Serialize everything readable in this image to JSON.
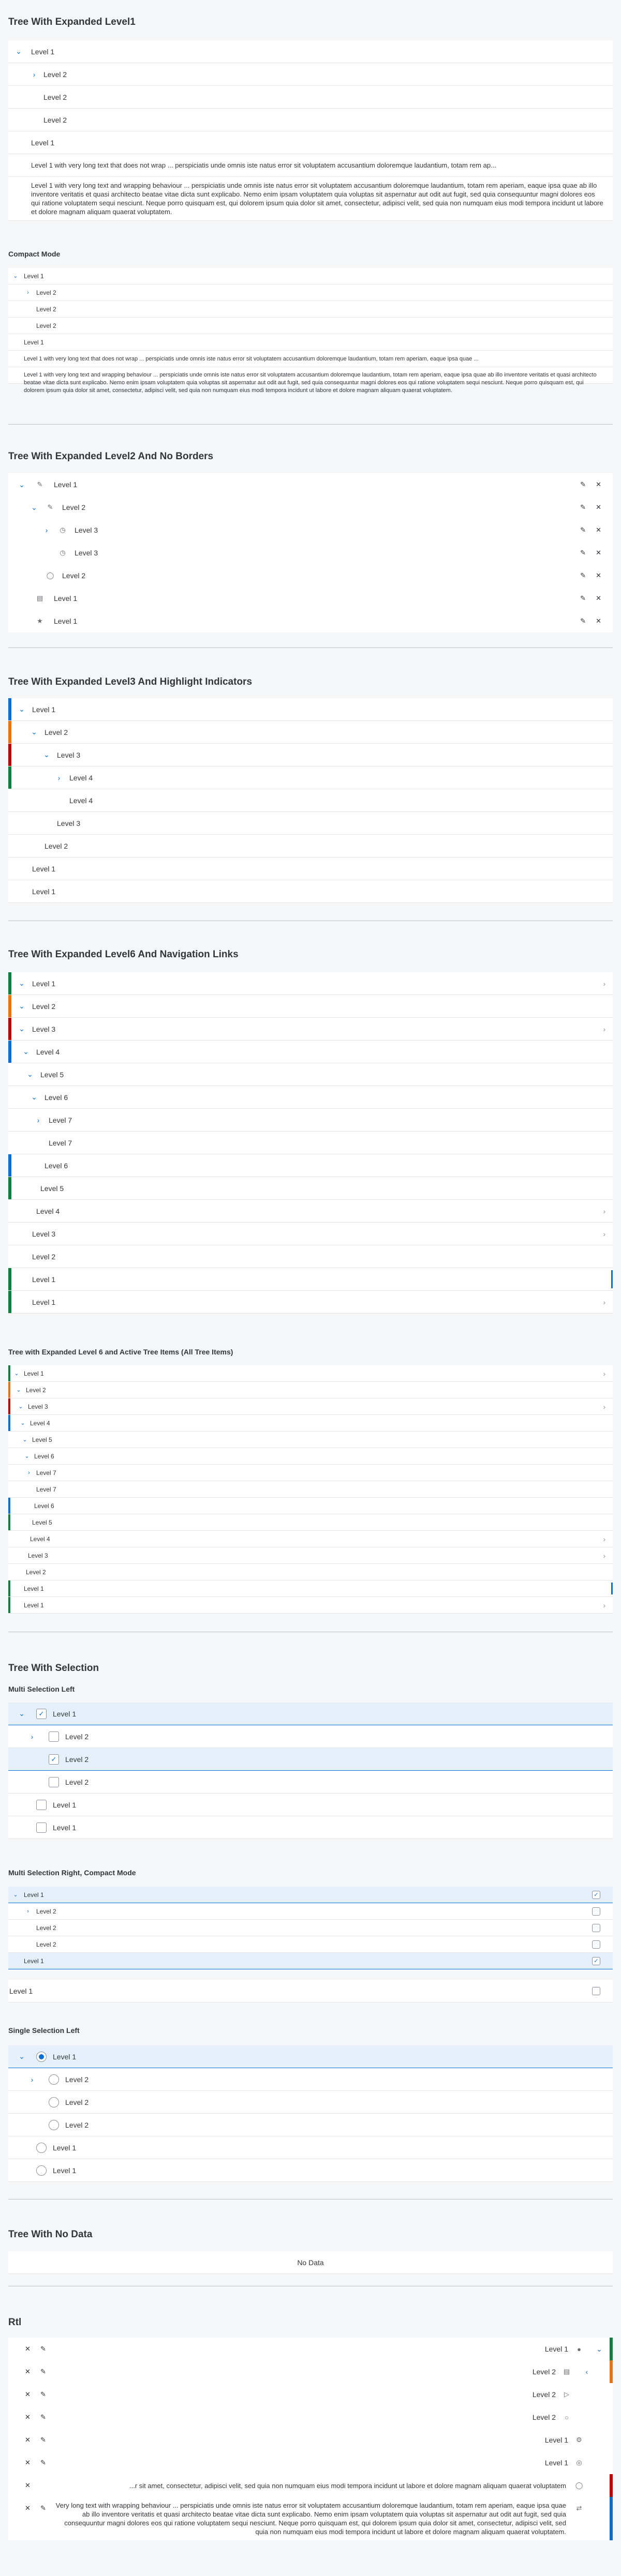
{
  "colors": {
    "accent": "#0a6ed1",
    "negative": "#bb0000",
    "critical": "#e9730c",
    "positive": "#107e3e",
    "info": "#0a6ed1"
  },
  "sections": {
    "s1": "Tree With Expanded Level1",
    "s1c": "Compact Mode",
    "s2": "Tree With Expanded Level2 And No Borders",
    "s3": "Tree With Expanded Level3 And Highlight Indicators",
    "s4": "Tree With Expanded Level6 And Navigation Links",
    "s4c": "Tree with Expanded Level 6 and Active Tree Items (All Tree Items)",
    "s5": "Tree With Selection",
    "s5a": "Multi Selection Left",
    "s5b": "Multi Selection Right, Compact Mode",
    "s5c": "Single Selection Left",
    "s6": "Tree With No Data",
    "s7": "Rtl"
  },
  "labels": {
    "l1": "Level 1",
    "l2": "Level 2",
    "l3": "Level 3",
    "l4": "Level 4",
    "l5": "Level 5",
    "l6": "Level 6",
    "l7": "Level 7",
    "nodata": "No Data"
  },
  "texts": {
    "trunc": "Level 1 with very long text that does not wrap ... perspiciatis unde omnis iste natus error sit voluptatem accusantium doloremque laudantium, totam rem ap...",
    "trunc_c": "Level 1 with very long text that does not wrap ... perspiciatis unde omnis iste natus error sit voluptatem accusantium doloremque laudantium, totam rem aperiam, eaque ipsa quae ...",
    "wrap": "Level 1 with very long text and wrapping behaviour ... perspiciatis unde omnis iste natus error sit voluptatem accusantium doloremque laudantium, totam rem aperiam, eaque ipsa quae ab illo inventore veritatis et quasi architecto beatae vitae dicta sunt explicabo. Nemo enim ipsam voluptatem quia voluptas sit aspernatur aut odit aut fugit, sed quia consequuntur magni dolores eos qui ratione voluptatem sequi nesciunt. Neque porro quisquam est, qui dolorem ipsum quia dolor sit amet, consectetur, adipisci velit, sed quia non numquam eius modi tempora incidunt ut labore et dolore magnam aliquam quaerat voluptatem.",
    "wrap_c": "Level 1 with very long text and wrapping behaviour ... perspiciatis unde omnis iste natus error sit voluptatem accusantium doloremque laudantium, totam rem aperiam, eaque ipsa quae ab illo inventore veritatis et quasi architecto beatae vitae dicta sunt explicabo. Nemo enim ipsam voluptatem quia voluptas sit aspernatur aut odit aut fugit, sed quia consequuntur magni dolores eos qui ratione voluptatem sequi nesciunt. Neque porro quisquam est, qui dolorem ipsum quia dolor sit amet, consectetur, adipisci velit, sed quia non numquam eius modi tempora incidunt ut labore et dolore magnam aliquam quaerat voluptatem.",
    "rtl_trunc": "...r sit amet, consectetur, adipisci velit, sed quia non numquam eius modi tempora incidunt ut labore et dolore magnam aliquam quaerat voluptatem",
    "rtl_wrap": "Very long text with wrapping behaviour ... perspiciatis unde omnis iste natus error sit voluptatem accusantium doloremque laudantium, totam rem aperiam, eaque ipsa quae ab illo inventore veritatis et quasi architecto beatae vitae dicta sunt explicabo. Nemo enim ipsam voluptatem quia voluptas sit aspernatur aut odit aut fugit, sed quia consequuntur magni dolores eos qui ratione voluptatem sequi nesciunt. Neque porro quisquam est, qui dolorem ipsum quia dolor sit amet, consectetur, adipisci velit, sed quia non numquam eius modi tempora incidunt ut labore et dolore magnam aliquam quaerat voluptatem."
  }
}
